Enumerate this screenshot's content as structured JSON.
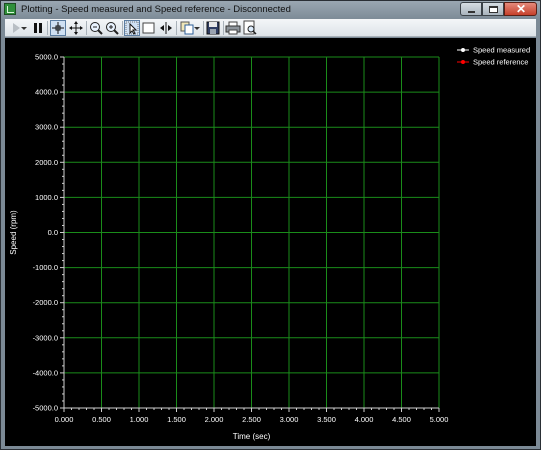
{
  "window": {
    "title": "Plotting  - Speed measured and Speed reference - Disconnected"
  },
  "toolbar": {
    "icons": [
      "play-icon",
      "dropdown-arrow-icon",
      "pause-icon",
      "crosshair-icon",
      "pan-icon",
      "zoom-out-icon",
      "zoom-in-icon",
      "pointer-select-icon",
      "box-select-icon",
      "fit-width-icon",
      "copy-icon",
      "save-icon",
      "print-icon",
      "print-preview-icon"
    ]
  },
  "colors": {
    "background": "#000000",
    "grid": "#1a8c1a",
    "axis_text": "#ffffff",
    "speed_measured": "#ffffff",
    "speed_reference": "#ff0000"
  },
  "chart_data": {
    "type": "line",
    "xlabel": "Time (sec)",
    "ylabel": "Speed (rpm)",
    "xlim": [
      0,
      5
    ],
    "ylim": [
      -5000,
      5000
    ],
    "x_ticks": [
      "0.000",
      "0.500",
      "1.000",
      "1.500",
      "2.000",
      "2.500",
      "3.000",
      "3.500",
      "4.000",
      "4.500",
      "5.000"
    ],
    "y_ticks": [
      "5000.0",
      "4000.0",
      "3000.0",
      "2000.0",
      "1000.0",
      "0.0",
      "-1000.0",
      "-2000.0",
      "-3000.0",
      "-4000.0",
      "-5000.0"
    ],
    "grid": true,
    "legend_position": "top-right",
    "series": [
      {
        "name": "Speed measured",
        "color": "#ffffff",
        "x": [],
        "y": []
      },
      {
        "name": "Speed reference",
        "color": "#ff0000",
        "x": [],
        "y": []
      }
    ]
  }
}
